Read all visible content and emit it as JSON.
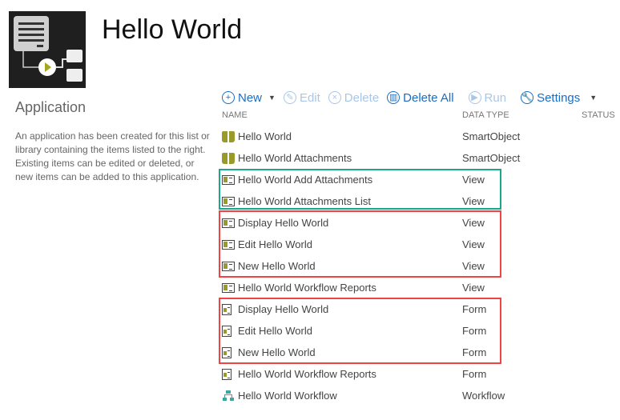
{
  "header": {
    "title": "Hello World"
  },
  "sidebar": {
    "heading": "Application",
    "description": "An application has been created for this list or library containing the items listed to the right. Existing items can be edited or deleted, or new items can be added to this application."
  },
  "toolbar": {
    "new": "New",
    "edit": "Edit",
    "delete": "Delete",
    "delete_all": "Delete All",
    "run": "Run",
    "settings": "Settings"
  },
  "columns": {
    "name": "NAME",
    "type": "DATA TYPE",
    "status": "STATUS"
  },
  "items": [
    {
      "name": "Hello World",
      "type": "SmartObject",
      "icon": "smartobject-icon"
    },
    {
      "name": "Hello World Attachments",
      "type": "SmartObject",
      "icon": "smartobject-icon"
    },
    {
      "name": "Hello World Add Attachments",
      "type": "View",
      "icon": "view-icon"
    },
    {
      "name": "Hello World Attachments List",
      "type": "View",
      "icon": "view-icon"
    },
    {
      "name": "Display Hello World",
      "type": "View",
      "icon": "view-icon"
    },
    {
      "name": "Edit Hello World",
      "type": "View",
      "icon": "view-icon"
    },
    {
      "name": "New Hello World",
      "type": "View",
      "icon": "view-icon"
    },
    {
      "name": "Hello World Workflow Reports",
      "type": "View",
      "icon": "view-icon"
    },
    {
      "name": "Display Hello World",
      "type": "Form",
      "icon": "form-icon"
    },
    {
      "name": "Edit Hello World",
      "type": "Form",
      "icon": "form-icon"
    },
    {
      "name": "New Hello World",
      "type": "Form",
      "icon": "form-icon"
    },
    {
      "name": "Hello World Workflow Reports",
      "type": "Form",
      "icon": "form-icon"
    },
    {
      "name": "Hello World Workflow",
      "type": "Workflow",
      "icon": "workflow-icon"
    }
  ],
  "colors": {
    "accent": "#1a6dc4",
    "highlight_green": "#1aa88a",
    "highlight_red": "#ee4444"
  }
}
